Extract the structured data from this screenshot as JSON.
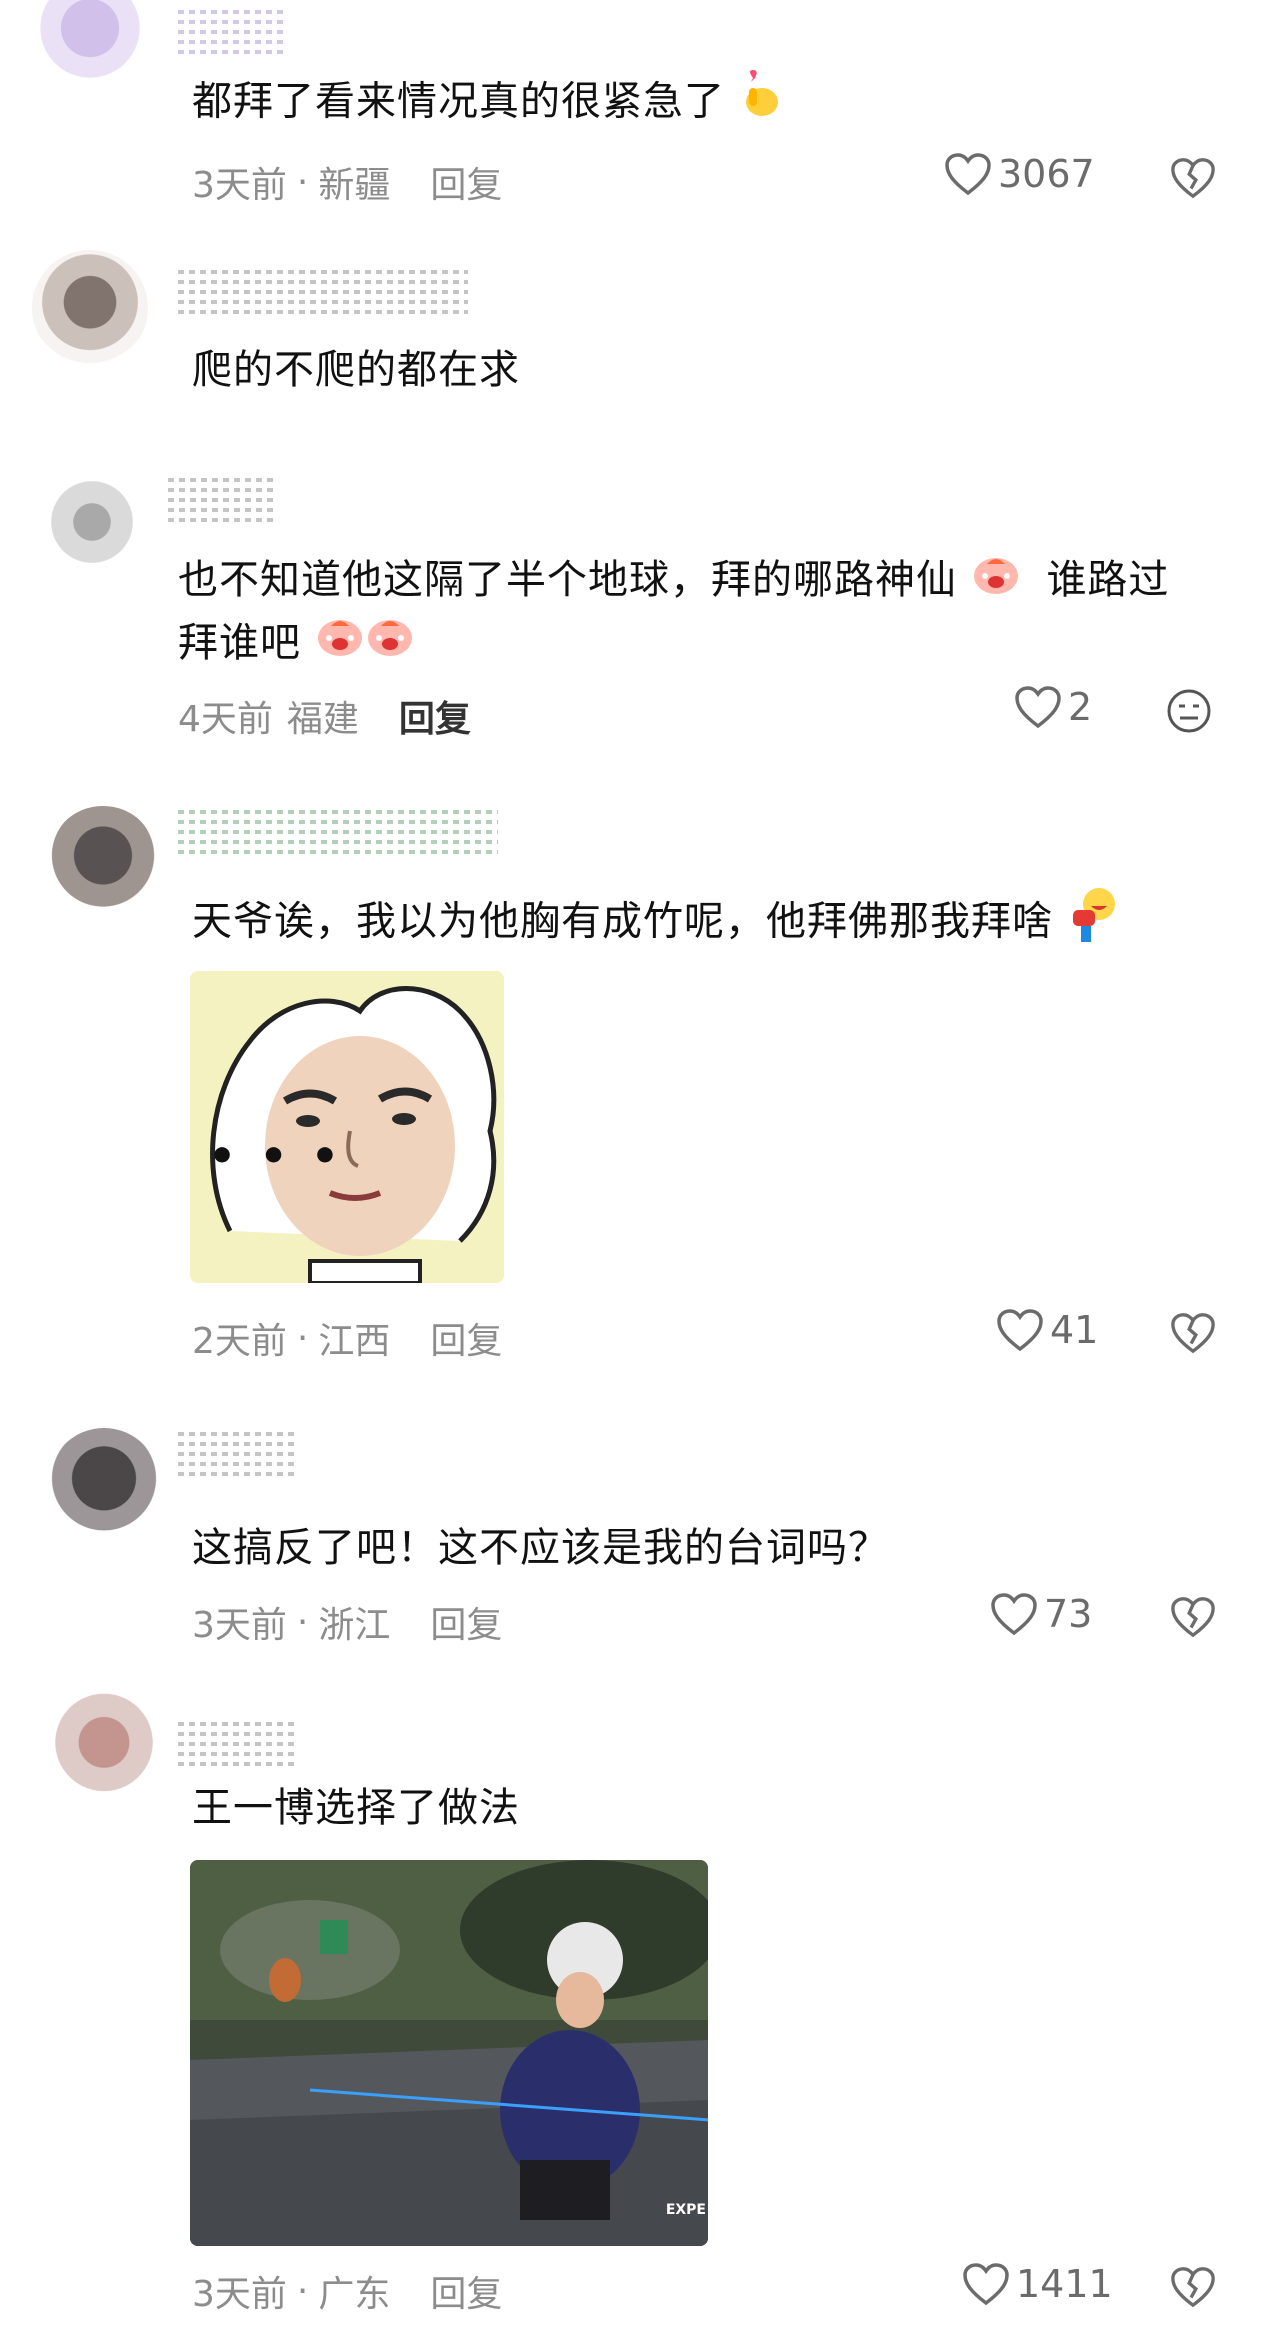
{
  "comments": [
    {
      "text": "都拜了看来情况真的很紧急了",
      "time": "3天前",
      "location": "新疆",
      "reply": "回复",
      "likes": "3067"
    },
    {
      "text": "爬的不爬的都在求"
    },
    {
      "text_line1": "也不知道他这隔了半个地球，拜的哪路神仙",
      "text_line1b": "谁路过",
      "text_line2": "拜谁吧",
      "time": "4天前",
      "location": "福建",
      "reply": "回复",
      "likes": "2"
    },
    {
      "text": "天爷诶，我以为他胸有成竹呢，他拜佛那我拜啥",
      "time": "2天前",
      "location": "江西",
      "reply": "回复",
      "likes": "41",
      "sticker_text": "• • •"
    },
    {
      "text": "这搞反了吧！这不应该是我的台词吗？",
      "time": "3天前",
      "location": "浙江",
      "reply": "回复",
      "likes": "73"
    },
    {
      "text": "王一博选择了做法",
      "time": "3天前",
      "location": "广东",
      "reply": "回复",
      "likes": "1411",
      "photo_corner_text": "EXPE"
    }
  ],
  "separator": "·",
  "icons": {
    "like": "heart-outline-icon",
    "dislike": "broken-heart-icon",
    "emoji": "neutral-face-icon"
  }
}
